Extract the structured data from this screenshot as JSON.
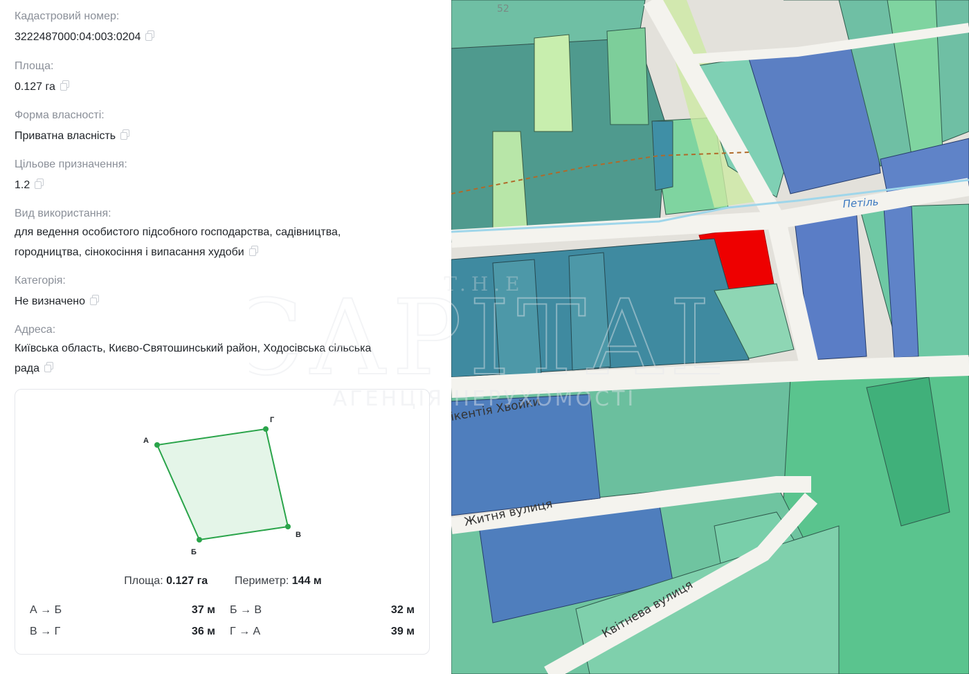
{
  "fields": [
    {
      "label": "Кадастровий номер:",
      "value": "3222487000:04:003:0204"
    },
    {
      "label": "Площа:",
      "value": "0.127 га"
    },
    {
      "label": "Форма власності:",
      "value": "Приватна власність"
    },
    {
      "label": "Цільове призначення:",
      "value": "1.2"
    },
    {
      "label": "Вид використання:",
      "value_line1": "для ведення особистого підсобного господарства, садівництва,",
      "value_line2": "городництва, сінокосіння і випасання худоби"
    },
    {
      "label": "Категорія:",
      "value": "Не визначено"
    },
    {
      "label": "Адреса:",
      "value_line1": "Київська область, Києво-Святошинський район, Ходосівська сільська",
      "value_line2": "рада"
    }
  ],
  "shape_card": {
    "vertices": [
      "А",
      "Б",
      "В",
      "Г"
    ],
    "area_label": "Площа:",
    "area_value": "0.127 га",
    "perimeter_label": "Периметр:",
    "perimeter_value": "144 м",
    "segments": [
      {
        "name": "А → Б",
        "length": "37 м"
      },
      {
        "name": "Б → В",
        "length": "32 м"
      },
      {
        "name": "В → Г",
        "length": "36 м"
      },
      {
        "name": "Г → А",
        "length": "39 м"
      }
    ]
  },
  "map": {
    "street_labels": [
      "ікентія Хвойки",
      "Житня вулиця",
      "Квітнева вулиця",
      "Петіль"
    ],
    "house_number": "52",
    "highlight_color": "#ee0000"
  },
  "watermark": {
    "line1": "T.H.E",
    "line2": "CAPITAL",
    "line3": "АГЕНЦІЯ НЕРУХОМОСТІ"
  }
}
